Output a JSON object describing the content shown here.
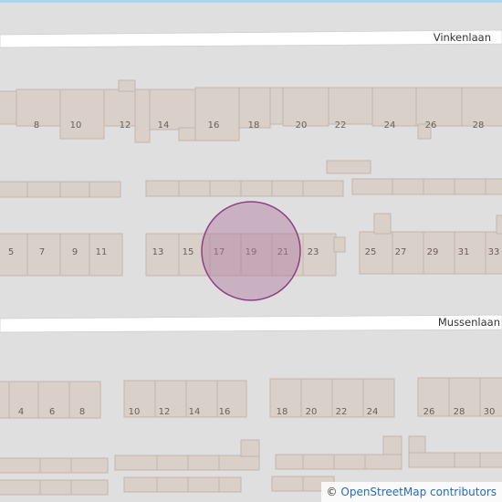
{
  "streets": {
    "north": "Vinkenlaan",
    "south": "Mussenlaan"
  },
  "house_numbers": {
    "vinkenlaan_south_side": [
      "8",
      "10",
      "12",
      "14",
      "16",
      "18",
      "20",
      "22",
      "24",
      "26",
      "28"
    ],
    "mussenlaan_north_side": [
      "5",
      "7",
      "9",
      "11",
      "13",
      "15",
      "17",
      "19",
      "21",
      "23",
      "25",
      "27",
      "29",
      "31",
      "33"
    ],
    "mussenlaan_south_side": [
      "4",
      "6",
      "8",
      "10",
      "12",
      "14",
      "16",
      "18",
      "20",
      "22",
      "24",
      "26",
      "28",
      "30"
    ]
  },
  "marker": {
    "shape": "circle",
    "fill": "#b07ba0",
    "stroke": "#8e3f86",
    "centered_on": "19"
  },
  "attribution": {
    "symbol": "©",
    "text": "OpenStreetMap contributors"
  },
  "colors": {
    "background": "#e0dfdf",
    "road": "#ffffff",
    "building": "#d9d0c9",
    "building_outline": "#c4b5aa",
    "water_edge": "#a8d8f0"
  }
}
